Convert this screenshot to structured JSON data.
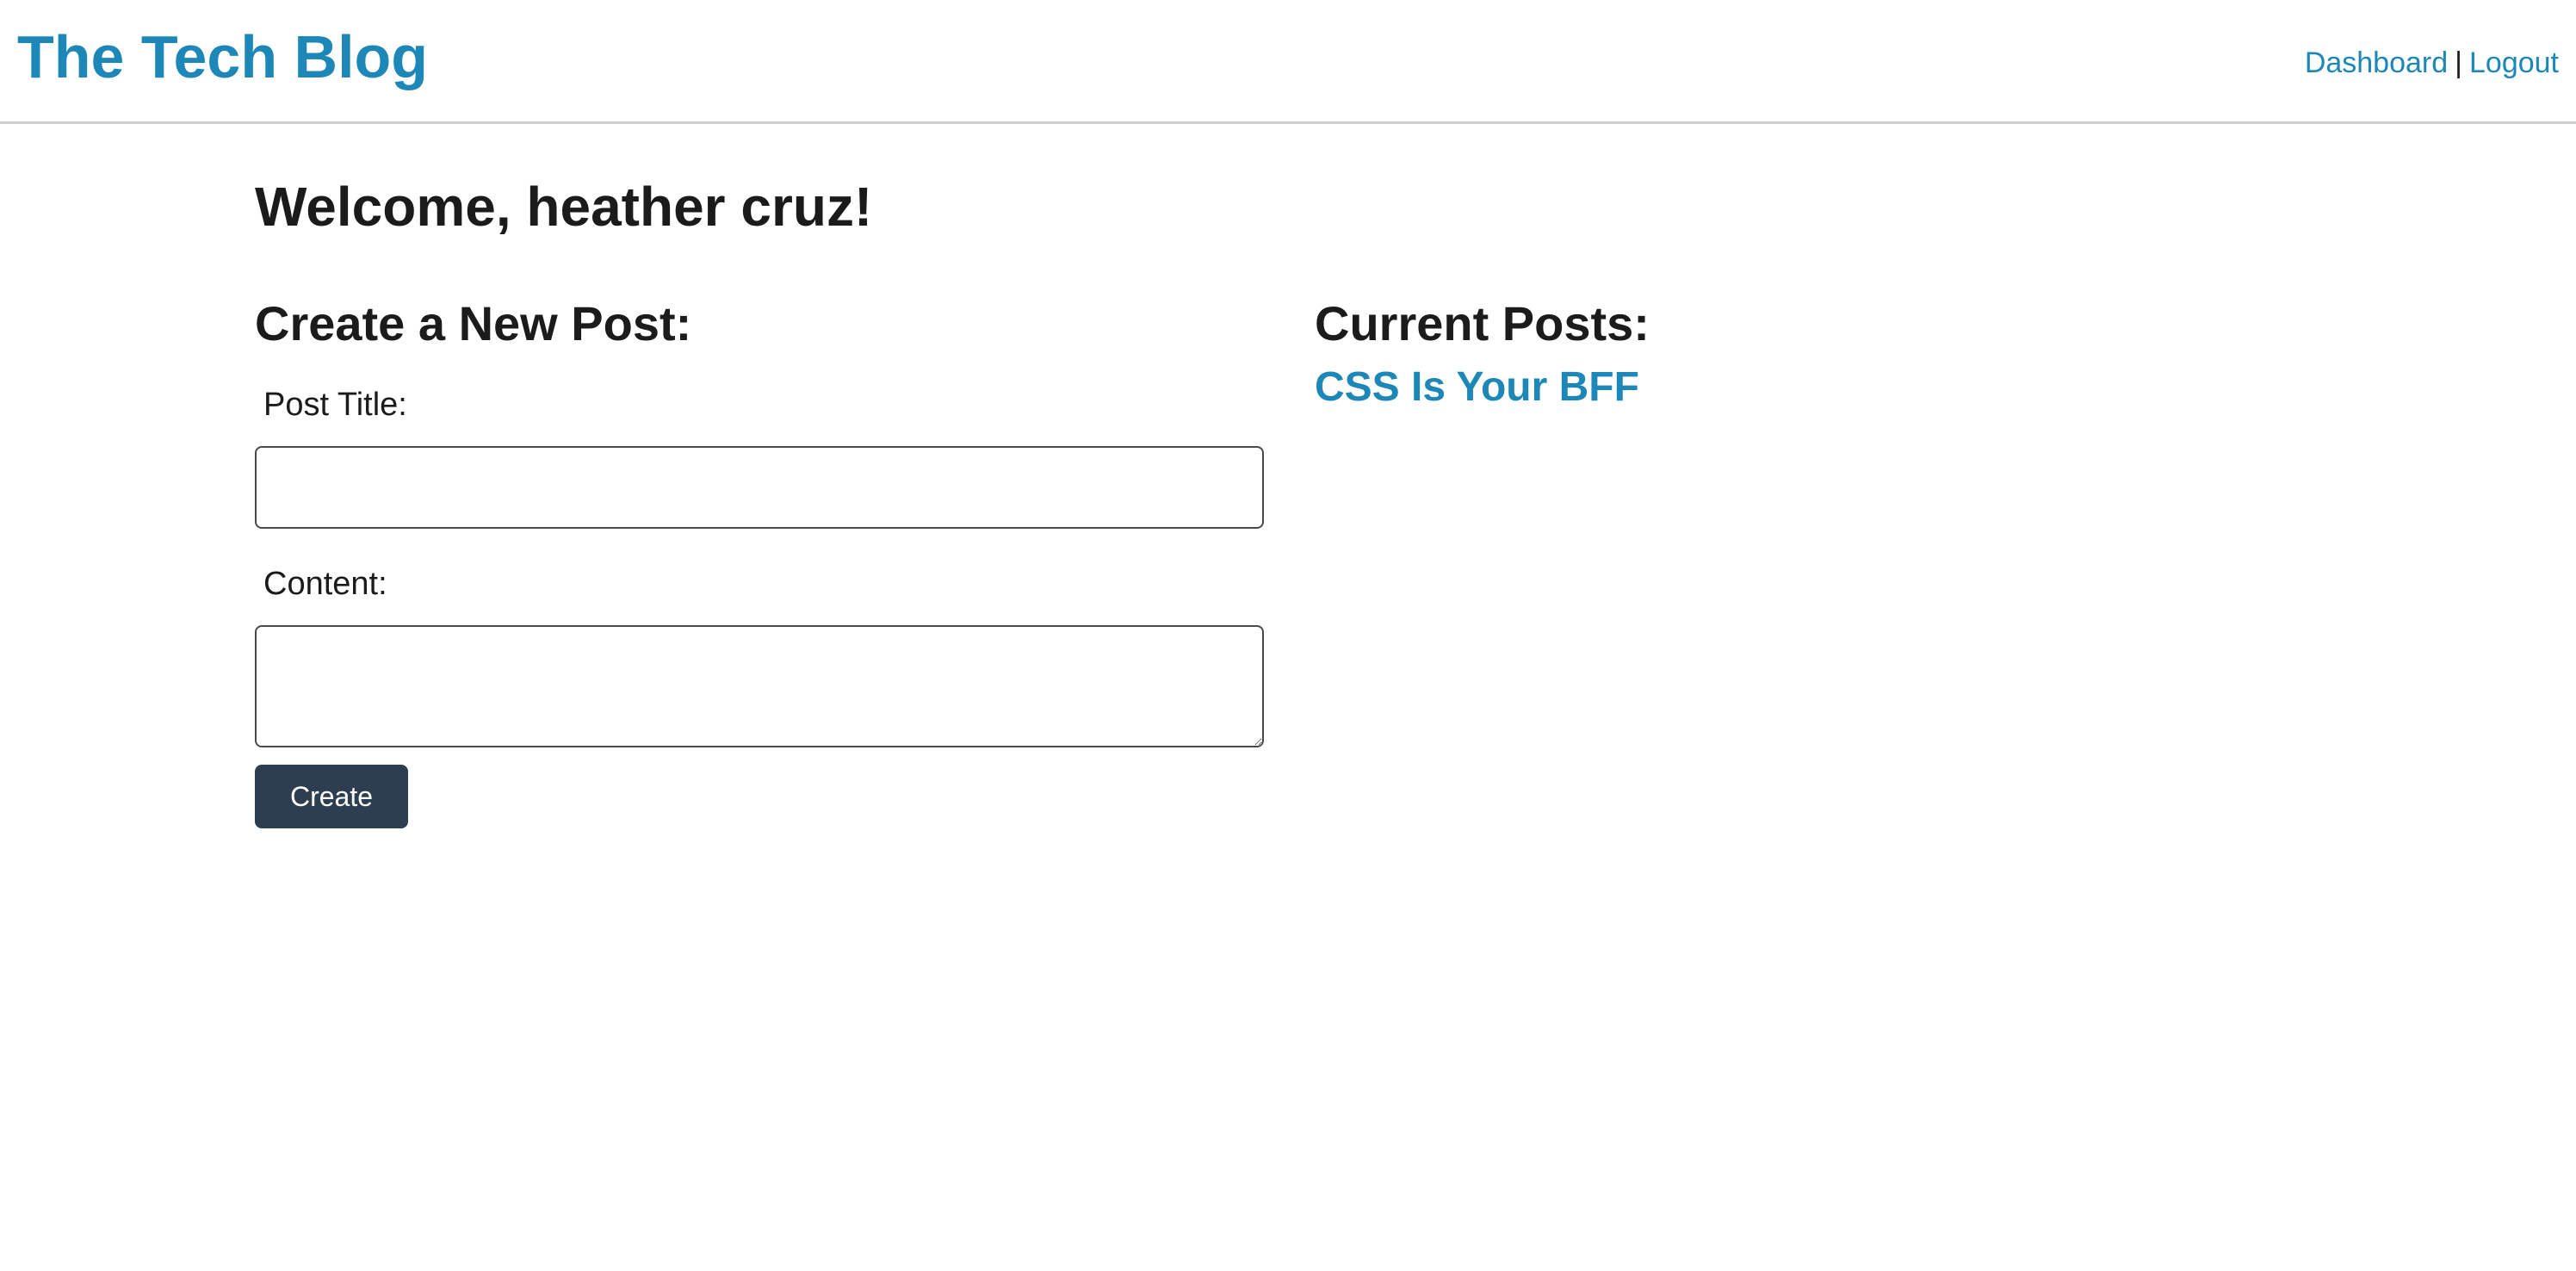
{
  "header": {
    "site_title": "The Tech Blog",
    "nav": {
      "dashboard_label": "Dashboard",
      "separator": "|",
      "logout_label": "Logout"
    }
  },
  "main": {
    "welcome": "Welcome, heather cruz!",
    "create_post": {
      "heading": "Create a New Post:",
      "title_label": "Post Title:",
      "title_value": "",
      "content_label": "Content:",
      "content_value": "",
      "create_button": "Create"
    },
    "current_posts": {
      "heading": "Current Posts:",
      "posts": [
        {
          "title": "CSS Is Your BFF"
        }
      ]
    }
  },
  "colors": {
    "brand": "#1d88b7",
    "button_bg": "#2d3e50",
    "text": "#1b1b1b"
  }
}
